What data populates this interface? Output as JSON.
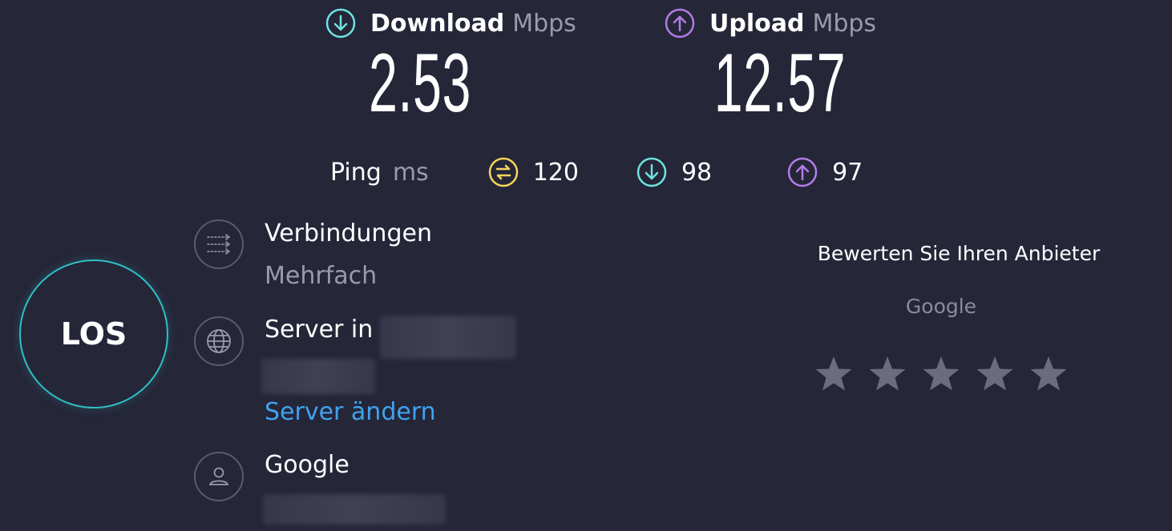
{
  "download": {
    "label": "Download",
    "unit": "Mbps",
    "value": "2.53",
    "icon": "arrow-down-circle-icon",
    "color": "#6fe3e1"
  },
  "upload": {
    "label": "Upload",
    "unit": "Mbps",
    "value": "12.57",
    "icon": "arrow-up-circle-icon",
    "color": "#b27de8"
  },
  "ping": {
    "label": "Ping",
    "unit": "ms",
    "idle": {
      "value": "120",
      "icon": "ping-exchange-icon",
      "color": "#f5d55a"
    },
    "download": {
      "value": "98",
      "icon": "arrow-down-circle-icon",
      "color": "#6fe3e1"
    },
    "upload": {
      "value": "97",
      "icon": "arrow-up-circle-icon",
      "color": "#b27de8"
    }
  },
  "go_button": {
    "label": "LOS",
    "border_color": "#2fbfc5"
  },
  "connections": {
    "title": "Verbindungen",
    "value": "Mehrfach",
    "icon": "connections-icon"
  },
  "server": {
    "title": "Server in",
    "change_link": "Server ändern",
    "icon": "globe-icon",
    "link_color": "#3fa3ef"
  },
  "provider": {
    "title": "Google",
    "icon": "user-icon"
  },
  "rating": {
    "title": "Bewerten Sie Ihren Anbieter",
    "provider": "Google",
    "stars": 5,
    "star_color": "#6b6c7e"
  },
  "colors": {
    "background": "#252638"
  }
}
